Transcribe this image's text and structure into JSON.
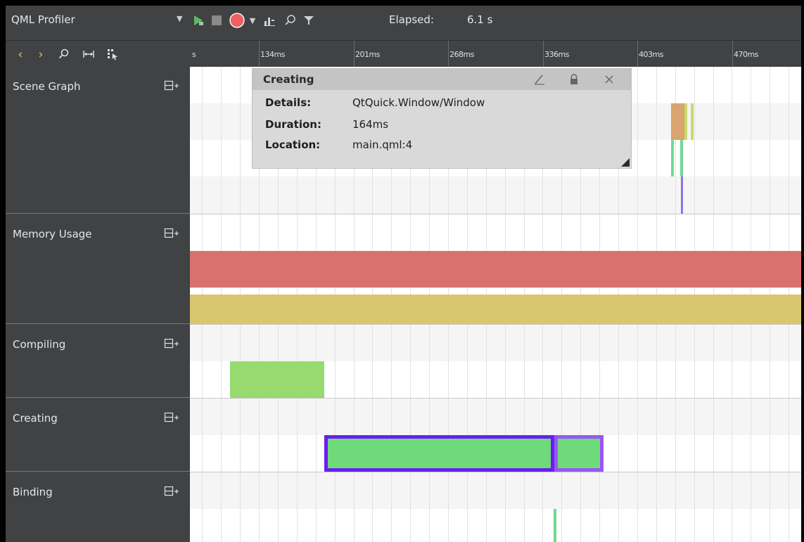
{
  "toolbar": {
    "title": "QML Profiler",
    "elapsed_label": "Elapsed:",
    "elapsed_value": "6.1 s"
  },
  "ruler": {
    "start_label": "s",
    "ticks": [
      "134ms",
      "201ms",
      "268ms",
      "336ms",
      "403ms",
      "470ms"
    ]
  },
  "categories": [
    {
      "name": "Scene Graph"
    },
    {
      "name": "Memory Usage"
    },
    {
      "name": "Compiling"
    },
    {
      "name": "Creating"
    },
    {
      "name": "Binding"
    }
  ],
  "tooltip": {
    "title": "Creating",
    "rows": [
      {
        "key": "Details:",
        "value": "QtQuick.Window/Window"
      },
      {
        "key": "Duration:",
        "value": "164ms"
      },
      {
        "key": "Location:",
        "value": "main.qml:4"
      }
    ]
  },
  "colors": {
    "chrome": "#404244",
    "memory_allocated": "#d9726f",
    "memory_used": "#d9c66f",
    "compiling": "#97da6f",
    "creating": "#6fda7a",
    "selection": "#6a1ef2",
    "selection_child": "#9956f5"
  },
  "icons": {
    "mode_dropdown": "chevron-down-icon",
    "start": "play-icon",
    "stop": "stop-icon",
    "record": "record-icon",
    "record_dropdown": "chevron-down-icon",
    "recorded_features": "bar-chart-icon",
    "search": "search-icon",
    "filter": "filter-icon",
    "prev": "chevron-left-icon",
    "next": "chevron-right-icon",
    "zoom": "zoom-icon",
    "range": "range-icon",
    "select_range": "select-range-icon",
    "expand": "expand-plus-icon",
    "edit_note": "pen-icon",
    "lock": "lock-icon",
    "close": "close-icon"
  }
}
